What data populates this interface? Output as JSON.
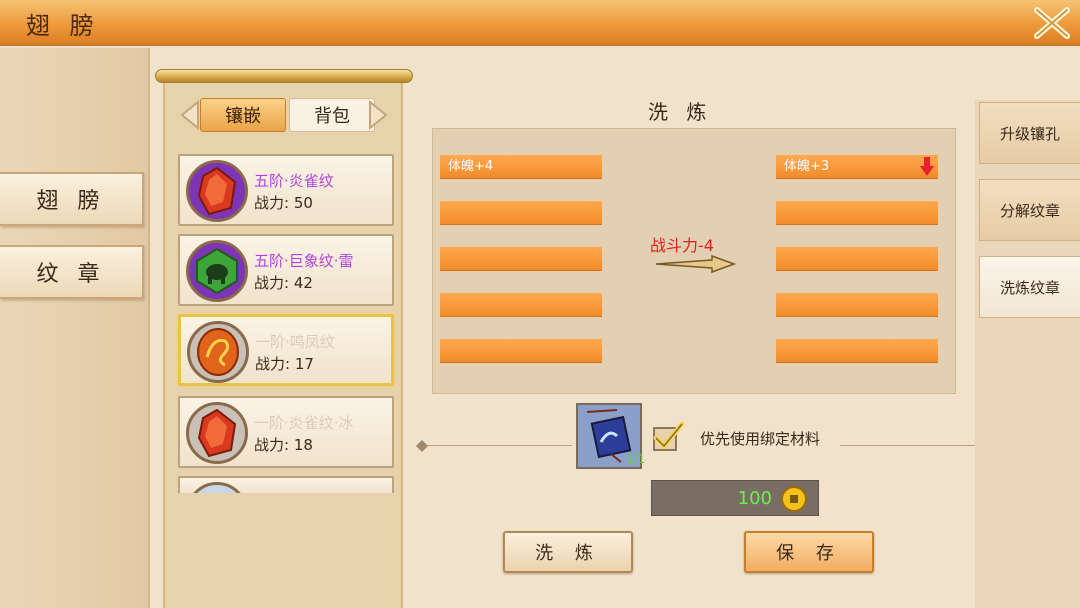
{
  "window": {
    "title": "翅 膀",
    "close_icon": "close-x-icon"
  },
  "sidebar": {
    "tabs": [
      {
        "label": "翅 膀"
      },
      {
        "label": "纹 章"
      }
    ]
  },
  "inventory": {
    "subtabs": [
      {
        "label": "镶嵌",
        "active": true
      },
      {
        "label": "背包",
        "active": false
      }
    ],
    "items": [
      {
        "name": "五阶·炎雀纹",
        "power": "战力: 50",
        "name_color": "#b044e0",
        "gem": "red-gem-icon",
        "ring": "#7d35b6"
      },
      {
        "name": "五阶·巨象纹·雷",
        "power": "战力: 42",
        "name_color": "#b044e0",
        "gem": "green-elephant-gem-icon",
        "ring": "#7d35b6"
      },
      {
        "name": "一阶·鸣凤纹",
        "power": "战力: 17",
        "name_color": "#d8ccc0",
        "gem": "phoenix-gem-icon",
        "ring": "#c9c0b6"
      },
      {
        "name": "一阶·炎雀纹·冰",
        "power": "战力: 18",
        "name_color": "#d8ccc0",
        "gem": "red-gem-icon",
        "ring": "#c9c0b6"
      }
    ]
  },
  "refine": {
    "title": "洗 炼",
    "left_attrs": [
      "体魄+4",
      "",
      "",
      "",
      ""
    ],
    "right_attrs": [
      "体魄+3",
      "",
      "",
      "",
      ""
    ],
    "power_change": "战斗力-4",
    "material_count": "1/1",
    "prefer_bound_label": "优先使用绑定材料",
    "prefer_bound_checked": true,
    "cost": "100",
    "refine_button": "洗 炼",
    "save_button": "保 存"
  },
  "right_tabs": [
    {
      "label": "升级镶孔",
      "active": false
    },
    {
      "label": "分解纹章",
      "active": false
    },
    {
      "label": "洗炼纹章",
      "active": true
    }
  ],
  "colors": {
    "accent_orange": "#f28c2b",
    "power_red": "#e0201a",
    "cost_green": "#6ef04a",
    "epic_purple": "#b044e0"
  }
}
